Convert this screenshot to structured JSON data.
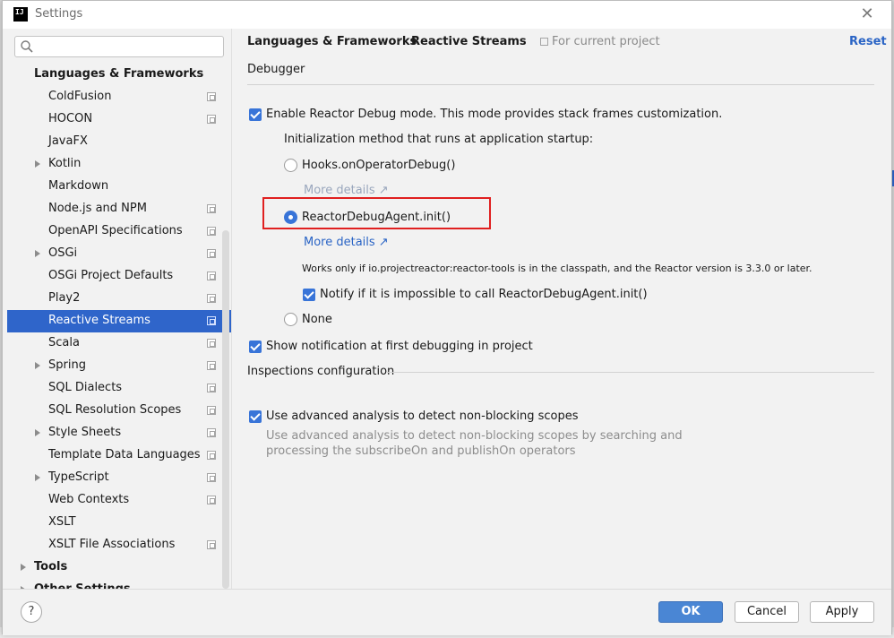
{
  "window": {
    "title": "Settings",
    "app_logo": "IJ"
  },
  "search": {
    "placeholder": ""
  },
  "sidebar": {
    "section": "Languages & Frameworks",
    "items": [
      {
        "label": "ColdFusion"
      },
      {
        "label": "HOCON"
      },
      {
        "label": "JavaFX"
      },
      {
        "label": "Kotlin"
      },
      {
        "label": "Markdown"
      },
      {
        "label": "Node.js and NPM"
      },
      {
        "label": "OpenAPI Specifications"
      },
      {
        "label": "OSGi"
      },
      {
        "label": "OSGi Project Defaults"
      },
      {
        "label": "Play2"
      },
      {
        "label": "Reactive Streams"
      },
      {
        "label": "Scala"
      },
      {
        "label": "Spring"
      },
      {
        "label": "SQL Dialects"
      },
      {
        "label": "SQL Resolution Scopes"
      },
      {
        "label": "Style Sheets"
      },
      {
        "label": "Template Data Languages"
      },
      {
        "label": "TypeScript"
      },
      {
        "label": "Web Contexts"
      },
      {
        "label": "XSLT"
      },
      {
        "label": "XSLT File Associations"
      }
    ],
    "tools": "Tools",
    "other": "Other Settings"
  },
  "header": {
    "crumb1": "Languages & Frameworks",
    "sep": "›",
    "crumb2": "Reactive Streams",
    "scope": "For current project",
    "reset": "Reset"
  },
  "debugger": {
    "title": "Debugger",
    "enable_label": "Enable Reactor Debug mode. This mode provides stack frames customization.",
    "init_label": "Initialization method that runs at application startup:",
    "hooks_label": "Hooks.onOperatorDebug()",
    "more1": "More details ↗",
    "agent_label": "ReactorDebugAgent.init()",
    "more2": "More details ↗",
    "works_note": "Works only if io.projectreactor:reactor-tools is in the classpath, and the Reactor version is 3.3.0 or later.",
    "notify_label": "Notify if it is impossible to call ReactorDebugAgent.init()",
    "none_label": "None",
    "show_notif_label": "Show notification at first debugging in project"
  },
  "inspections": {
    "title": "Inspections configuration",
    "advanced_label": "Use advanced analysis to detect non-blocking scopes",
    "desc_line1": "Use advanced analysis to detect non-blocking scopes by searching and",
    "desc_line2": "processing the subscribeOn and publishOn operators"
  },
  "footer": {
    "help": "?",
    "ok": "OK",
    "cancel": "Cancel",
    "apply": "Apply"
  }
}
